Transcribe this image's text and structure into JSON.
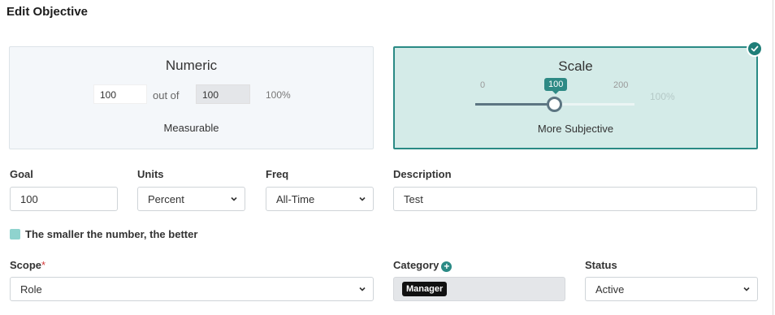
{
  "page": {
    "title": "Edit Objective"
  },
  "numeric_card": {
    "title": "Numeric",
    "value": "100",
    "out_of_label": "out of",
    "max_value": "100",
    "percent": "100%",
    "subtitle": "Measurable"
  },
  "scale_card": {
    "title": "Scale",
    "min": "0",
    "current": "100",
    "max": "200",
    "percent": "100%",
    "subtitle": "More Subjective",
    "slider_fraction": 0.5,
    "selected_icon": "check-icon"
  },
  "fields": {
    "goal": {
      "label": "Goal",
      "value": "100"
    },
    "units": {
      "label": "Units",
      "value": "Percent"
    },
    "freq": {
      "label": "Freq",
      "value": "All-Time"
    },
    "description": {
      "label": "Description",
      "value": "Test"
    }
  },
  "smaller_better": {
    "label": "The smaller the number, the better",
    "checked": true
  },
  "scope": {
    "label": "Scope",
    "required_mark": "*",
    "value": "Role"
  },
  "category": {
    "label": "Category",
    "add_icon": "plus-circle-icon",
    "tag": "Manager"
  },
  "status": {
    "label": "Status",
    "value": "Active"
  },
  "colors": {
    "accent": "#2a8a85",
    "selected_bg": "#d4ebe8",
    "required": "#d23a3a"
  }
}
